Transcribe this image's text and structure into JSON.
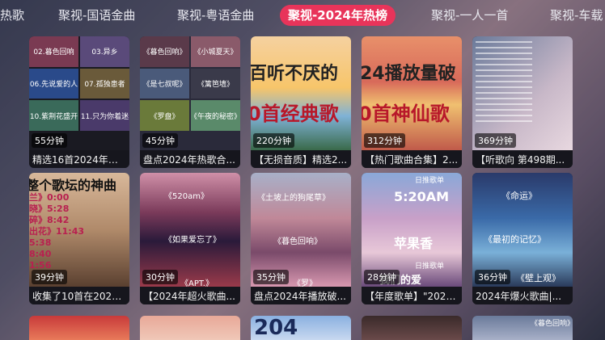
{
  "tabs": [
    {
      "label": "热歌"
    },
    {
      "label": "聚视-国语金曲"
    },
    {
      "label": "聚视-粤语金曲"
    },
    {
      "label": "聚视-2024年热榜"
    },
    {
      "label": "聚视-一人一首"
    },
    {
      "label": "聚视-车载"
    }
  ],
  "row1": [
    {
      "title": "精选16首2024年破...",
      "duration": "55分钟",
      "lines": [
        "02.暮色回响",
        "03.异乡",
        "06.先说爱的人",
        "07.孤独患者",
        "10.紫荆花盛开",
        "11.只为你着迷"
      ]
    },
    {
      "title": "盘点2024年热歌合...",
      "duration": "45分钟",
      "lines": [
        "《暮色回响》",
        "《小城夏天》",
        "《是七叔呢》",
        "《篱笆墙》",
        "《罗盘》",
        "《午夜的秘密》"
      ]
    },
    {
      "title": "【无损音质】精选2...",
      "duration": "220分钟",
      "big1": "百听不厌的",
      "big2": "0首经典歌"
    },
    {
      "title": "【热门歌曲合集】2...",
      "duration": "312分钟",
      "big1": "24播放量破",
      "big2": "0首神仙歌"
    },
    {
      "title": "【听歌向 第498期...",
      "duration": "369分钟"
    }
  ],
  "row2": [
    {
      "title": "收集了10首在2024...",
      "duration": "39分钟",
      "big1": "整个歌坛的神曲",
      "lines": [
        "兰》0:00",
        "晓》5:28",
        "碎》8:42",
        "出花》11:43",
        "5:38",
        "8:40",
        "1:56"
      ]
    },
    {
      "title": "【2024年超火歌曲...",
      "duration": "30分钟",
      "lines": [
        "《520am》",
        "《如果爱忘了》",
        "《APT.》"
      ]
    },
    {
      "title": "盘点2024年播放破...",
      "duration": "35分钟",
      "lines": [
        "《土坡上的狗尾草》",
        "《暮色回响》",
        "《罗》"
      ]
    },
    {
      "title": "【年度歌单】\"2024...",
      "duration": "28分钟",
      "lines": [
        "日推歌单",
        "5:20AM",
        "苹果香",
        "日推歌单",
        "我们的爱"
      ]
    },
    {
      "title": "2024年爆火歌曲|...",
      "duration": "36分钟",
      "lines": [
        "《命运》",
        "《最初的记忆》",
        "《壁上观》"
      ]
    }
  ],
  "row3_partial": [
    "",
    "",
    "204",
    "",
    "《暮色回响》"
  ]
}
